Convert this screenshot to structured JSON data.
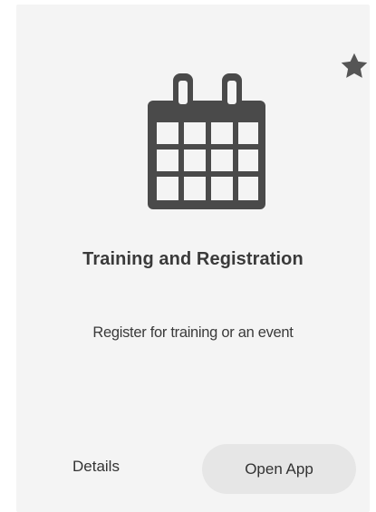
{
  "card": {
    "title": "Training and Registration",
    "description": "Register for training or an event",
    "icon": "calendar-icon",
    "favorite_icon": "star-icon",
    "details_label": "Details",
    "open_label": "Open App"
  },
  "colors": {
    "icon": "#4a4a4a",
    "card_bg": "#f4f4f4",
    "button_bg": "#e6e6e6",
    "text": "#3a3a3a"
  }
}
